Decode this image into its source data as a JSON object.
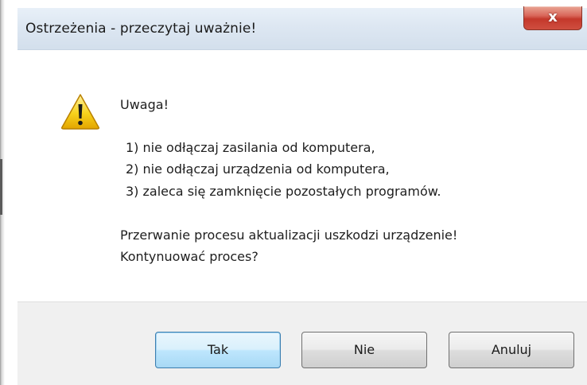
{
  "window": {
    "title": "Ostrzeżenia - przeczytaj uważnie!",
    "close_glyph": "x"
  },
  "message": {
    "icon": "warning-icon",
    "heading": "Uwaga!",
    "items": [
      "1) nie odłączaj zasilania od komputera,",
      "2) nie odłączaj urządzenia od komputera,",
      "3) zaleca się zamknięcie pozostałych programów."
    ],
    "warning_line": "Przerwanie procesu aktualizacji uszkodzi urządzenie!",
    "question": "Kontynuować proces?"
  },
  "buttons": {
    "yes": "Tak",
    "no": "Nie",
    "cancel": "Anuluj"
  },
  "colors": {
    "titlebar": "#dde7f2",
    "close_button": "#c4382b",
    "footer": "#f0f0f0",
    "default_button_border": "#3c7fb1"
  }
}
